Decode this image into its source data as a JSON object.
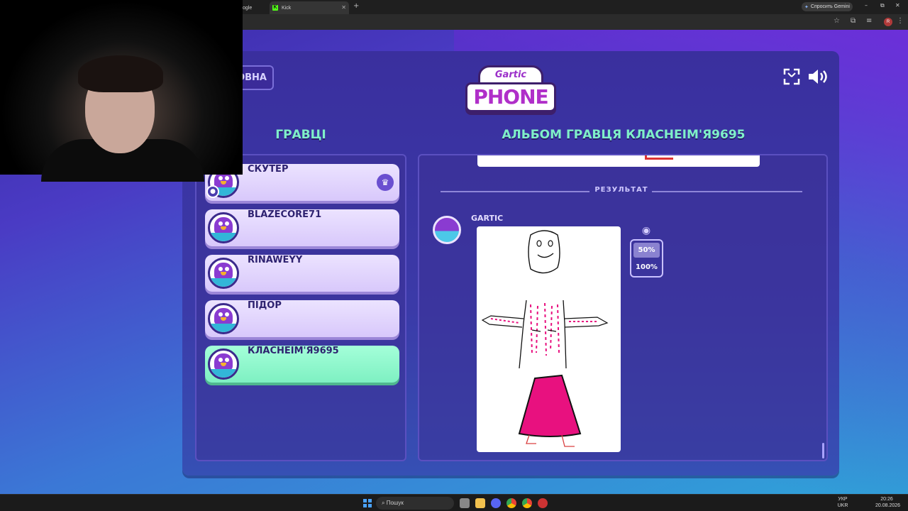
{
  "browser": {
    "tabs": [
      {
        "label": "ogle"
      },
      {
        "label": "Kick",
        "icon": "kick-icon"
      }
    ],
    "gemini_label": "Спросить Gemini",
    "window_controls": [
      "–",
      "⧉",
      "✕"
    ]
  },
  "game": {
    "back_label": "ОВНА",
    "logo_top": "Gartic",
    "logo_bottom": "PHONE",
    "players_title": "ГРАВЦІ",
    "album_title": "АЛЬБОМ ГРАВЦЯ КЛАСНЕІМ'Я9695",
    "players": [
      {
        "name": "СКУТЕР",
        "host": true
      },
      {
        "name": "BLAZECORE71"
      },
      {
        "name": "RINAWEYY"
      },
      {
        "name": "ПІДОР"
      },
      {
        "name": "КЛАСНЕІМ'Я9695",
        "current": true
      }
    ],
    "result_label": "РЕЗУЛЬТАТ",
    "author_name": "GARTIC",
    "zoom_options": [
      "50%",
      "100%"
    ],
    "zoom_selected": "50%",
    "colors": {
      "accent_green": "#7ff0c9",
      "skirt_pink": "#e8117f"
    }
  },
  "taskbar": {
    "search_placeholder": "Пошук",
    "lang_top": "УКР",
    "lang_bottom": "UKR",
    "time": "20:26",
    "date": "20.08.2026"
  }
}
